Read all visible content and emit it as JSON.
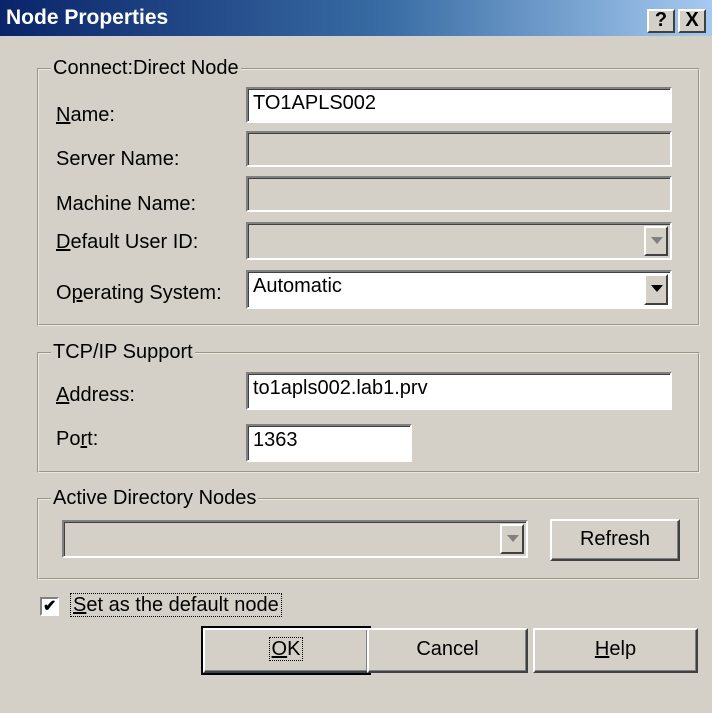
{
  "window": {
    "title": "Node Properties",
    "help_button": "?",
    "close_button": "X"
  },
  "connect_direct": {
    "legend": "Connect:Direct Node",
    "name": {
      "access": "N",
      "rest": "ame:",
      "value": "TO1APLS002"
    },
    "server_name": {
      "label": "Server Name:",
      "value": ""
    },
    "machine_name": {
      "label": "Machine Name:",
      "value": ""
    },
    "default_user_id": {
      "access": "D",
      "rest": "efault User ID:",
      "value": ""
    },
    "operating_system": {
      "pre": "O",
      "access": "p",
      "rest": "erating System:",
      "value": "Automatic"
    }
  },
  "tcpip": {
    "legend": "TCP/IP Support",
    "address": {
      "access": "A",
      "rest": "ddress:",
      "value": "to1apls002.lab1.prv"
    },
    "port": {
      "pre": "Po",
      "access": "r",
      "rest": "t:",
      "value": "1363"
    }
  },
  "active_directory": {
    "legend": "Active Directory Nodes",
    "selected": "",
    "refresh_label": "Refresh"
  },
  "default_node": {
    "checked": true,
    "access": "S",
    "rest": "et as the default node"
  },
  "buttons": {
    "ok": {
      "access": "O",
      "rest": "K"
    },
    "cancel": "Cancel",
    "help": {
      "access": "H",
      "rest": "elp"
    }
  },
  "colors": {
    "title_start": "#0a246a",
    "title_end": "#a6caf0",
    "face": "#d4d0c8"
  }
}
